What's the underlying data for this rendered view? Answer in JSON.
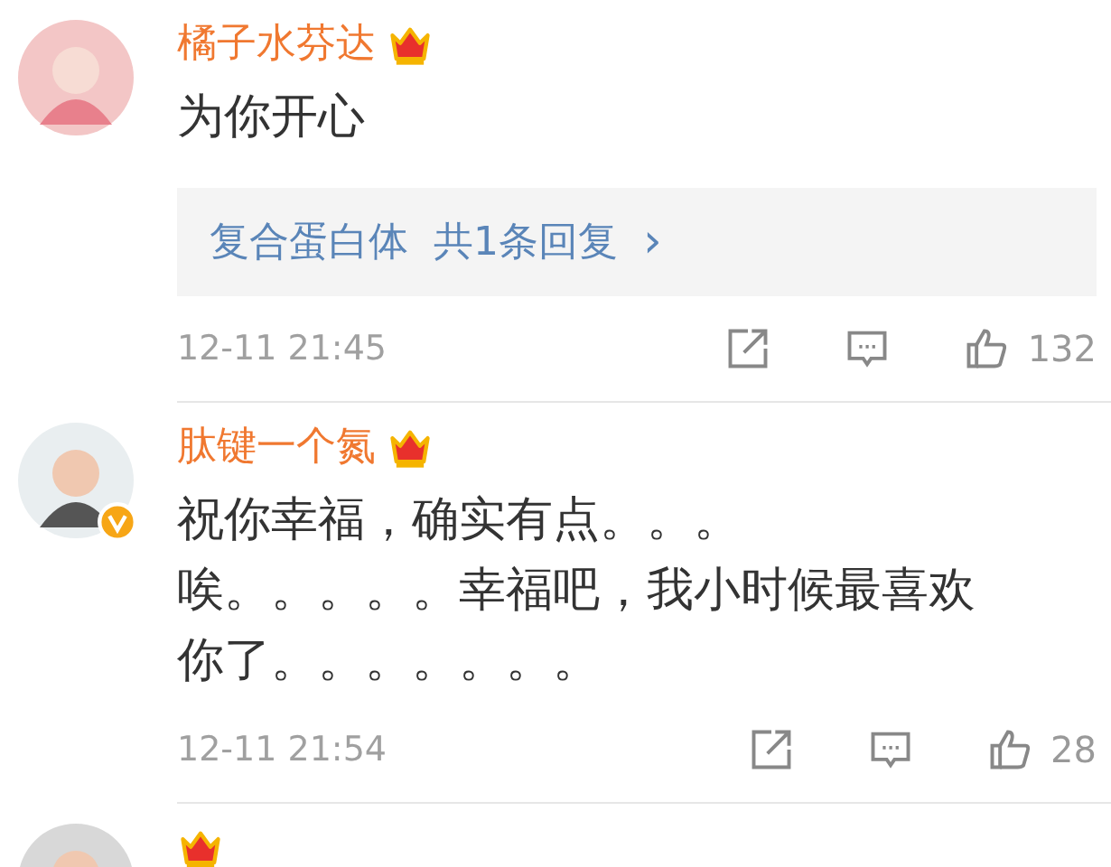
{
  "comments": [
    {
      "name": "橘子水芬达",
      "vip": true,
      "verified": false,
      "lines": [
        "为你开心"
      ],
      "replies": {
        "author": "复合蛋白体",
        "count": "共1条回复",
        "chevron": "›"
      },
      "time": "12-11 21:45",
      "likes": "132"
    },
    {
      "name": "肽键一个氮",
      "vip": true,
      "verified": true,
      "lines": [
        "祝你幸福，确实有点。。。",
        "唉。。。。。幸福吧，我小时候最喜欢",
        "你了。。。。。。。"
      ],
      "time": "12-11 21:54",
      "likes": "28"
    },
    {
      "vip": true,
      "verified": false
    }
  ]
}
